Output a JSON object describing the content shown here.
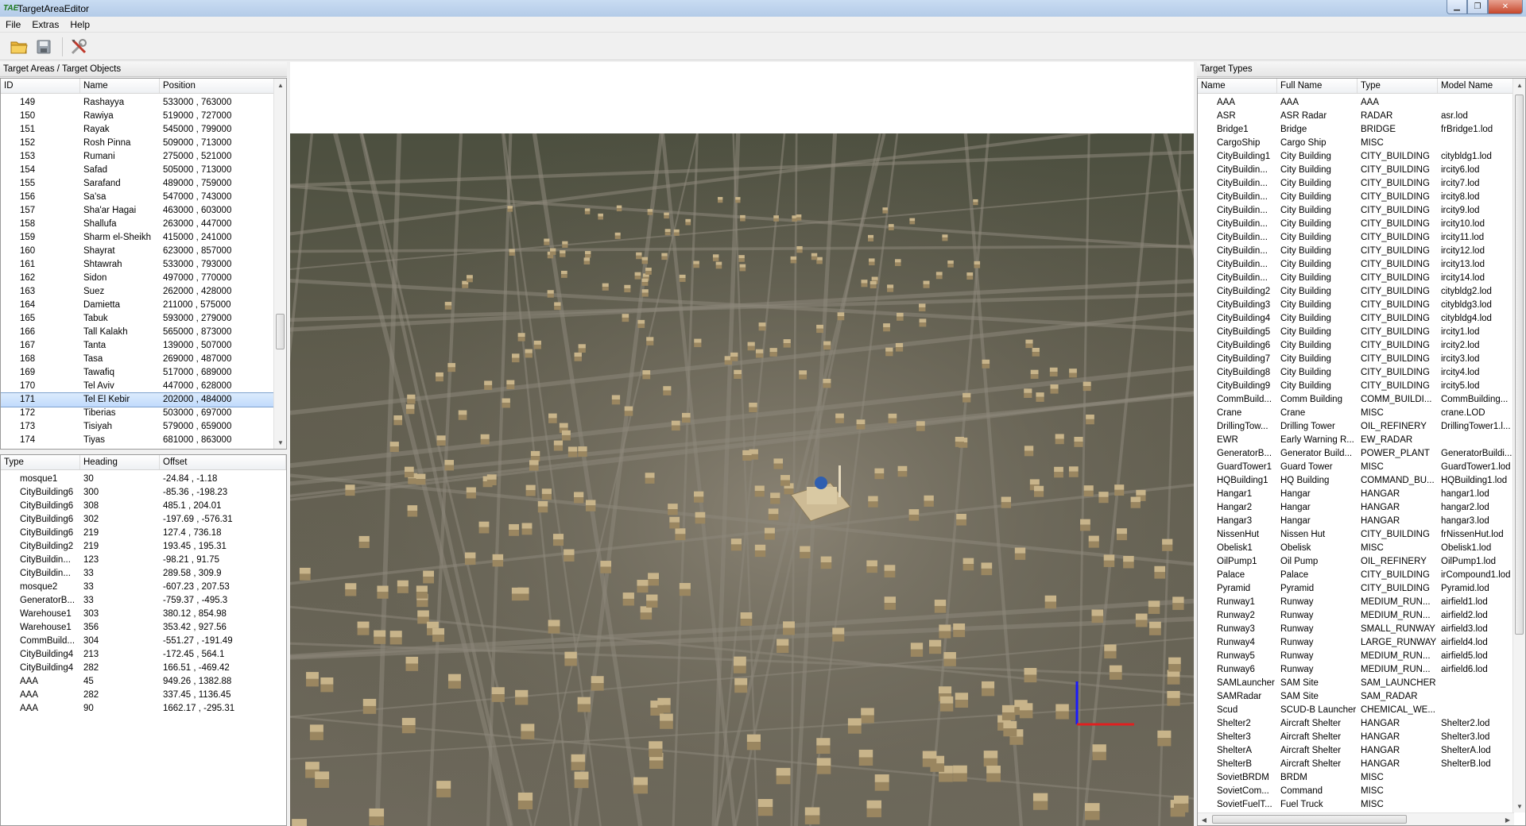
{
  "window": {
    "title": "TargetAreaEditor",
    "app_icon": "TAE"
  },
  "menu": {
    "items": [
      "File",
      "Extras",
      "Help"
    ]
  },
  "toolbar": {
    "icons": [
      "open-folder-icon",
      "save-disk-icon",
      "tools-icon"
    ]
  },
  "areas_panel": {
    "title": "Target Areas / Target Objects",
    "columns": [
      "ID",
      "Name",
      "Position"
    ],
    "rows": [
      [
        "149",
        "Rashayya",
        "533000 , 763000"
      ],
      [
        "150",
        "Rawiya",
        "519000 , 727000"
      ],
      [
        "151",
        "Rayak",
        "545000 , 799000"
      ],
      [
        "152",
        "Rosh Pinna",
        "509000 , 713000"
      ],
      [
        "153",
        "Rumani",
        "275000 , 521000"
      ],
      [
        "154",
        "Safad",
        "505000 , 713000"
      ],
      [
        "155",
        "Sarafand",
        "489000 , 759000"
      ],
      [
        "156",
        "Sa'sa",
        "547000 , 743000"
      ],
      [
        "157",
        "Sha'ar Hagai",
        "463000 , 603000"
      ],
      [
        "158",
        "Shallufa",
        "263000 , 447000"
      ],
      [
        "159",
        "Sharm el-Sheikh",
        "415000 , 241000"
      ],
      [
        "160",
        "Shayrat",
        "623000 , 857000"
      ],
      [
        "161",
        "Shtawrah",
        "533000 , 793000"
      ],
      [
        "162",
        "Sidon",
        "497000 , 770000"
      ],
      [
        "163",
        "Suez",
        "262000 , 428000"
      ],
      [
        "164",
        "Damietta",
        "211000 , 575000"
      ],
      [
        "165",
        "Tabuk",
        "593000 , 279000"
      ],
      [
        "166",
        "Tall Kalakh",
        "565000 , 873000"
      ],
      [
        "167",
        "Tanta",
        "139000 , 507000"
      ],
      [
        "168",
        "Tasa",
        "269000 , 487000"
      ],
      [
        "169",
        "Tawafiq",
        "517000 , 689000"
      ],
      [
        "170",
        "Tel Aviv",
        "447000 , 628000"
      ],
      [
        "171",
        "Tel El Kebir",
        "202000 , 484000"
      ],
      [
        "172",
        "Tiberias",
        "503000 , 697000"
      ],
      [
        "173",
        "Tisiyah",
        "579000 , 659000"
      ],
      [
        "174",
        "Tiyas",
        "681000 , 863000"
      ]
    ],
    "selected_id": "171"
  },
  "objects_panel": {
    "columns": [
      "Type",
      "Heading",
      "Offset"
    ],
    "rows": [
      [
        "mosque1",
        "30",
        "-24.84 , -1.18"
      ],
      [
        "CityBuilding6",
        "300",
        "-85.36 , -198.23"
      ],
      [
        "CityBuilding6",
        "308",
        "485.1 , 204.01"
      ],
      [
        "CityBuilding6",
        "302",
        "-197.69 , -576.31"
      ],
      [
        "CityBuilding6",
        "219",
        "127.4 , 736.18"
      ],
      [
        "CityBuilding2",
        "219",
        "193.45 , 195.31"
      ],
      [
        "CityBuildin...",
        "123",
        "-98.21 , 91.75"
      ],
      [
        "CityBuildin...",
        "33",
        "289.58 , 309.9"
      ],
      [
        "mosque2",
        "33",
        "-607.23 , 207.53"
      ],
      [
        "GeneratorB...",
        "33",
        "-759.37 , -495.3"
      ],
      [
        "Warehouse1",
        "303",
        "380.12 , 854.98"
      ],
      [
        "Warehouse1",
        "356",
        "353.42 , 927.56"
      ],
      [
        "CommBuild...",
        "304",
        "-551.27 , -191.49"
      ],
      [
        "CityBuilding4",
        "213",
        "-172.45 , 564.1"
      ],
      [
        "CityBuilding4",
        "282",
        "166.51 , -469.42"
      ],
      [
        "AAA",
        "45",
        "949.26 , 1382.88"
      ],
      [
        "AAA",
        "282",
        "337.45 , 1136.45"
      ],
      [
        "AAA",
        "90",
        "1662.17 , -295.31"
      ]
    ]
  },
  "types_panel": {
    "title": "Target Types",
    "columns": [
      "Name",
      "Full Name",
      "Type",
      "Model Name"
    ],
    "rows": [
      [
        "AAA",
        "AAA",
        "AAA",
        ""
      ],
      [
        "ASR",
        "ASR Radar",
        "RADAR",
        "asr.lod"
      ],
      [
        "Bridge1",
        "Bridge",
        "BRIDGE",
        "frBridge1.lod"
      ],
      [
        "CargoShip",
        "Cargo Ship",
        "MISC",
        ""
      ],
      [
        "CityBuilding1",
        "City Building",
        "CITY_BUILDING",
        "citybldg1.lod"
      ],
      [
        "CityBuildin...",
        "City Building",
        "CITY_BUILDING",
        "ircity6.lod"
      ],
      [
        "CityBuildin...",
        "City Building",
        "CITY_BUILDING",
        "ircity7.lod"
      ],
      [
        "CityBuildin...",
        "City Building",
        "CITY_BUILDING",
        "ircity8.lod"
      ],
      [
        "CityBuildin...",
        "City Building",
        "CITY_BUILDING",
        "ircity9.lod"
      ],
      [
        "CityBuildin...",
        "City Building",
        "CITY_BUILDING",
        "ircity10.lod"
      ],
      [
        "CityBuildin...",
        "City Building",
        "CITY_BUILDING",
        "ircity11.lod"
      ],
      [
        "CityBuildin...",
        "City Building",
        "CITY_BUILDING",
        "ircity12.lod"
      ],
      [
        "CityBuildin...",
        "City Building",
        "CITY_BUILDING",
        "ircity13.lod"
      ],
      [
        "CityBuildin...",
        "City Building",
        "CITY_BUILDING",
        "ircity14.lod"
      ],
      [
        "CityBuilding2",
        "City Building",
        "CITY_BUILDING",
        "citybldg2.lod"
      ],
      [
        "CityBuilding3",
        "City Building",
        "CITY_BUILDING",
        "citybldg3.lod"
      ],
      [
        "CityBuilding4",
        "City Building",
        "CITY_BUILDING",
        "citybldg4.lod"
      ],
      [
        "CityBuilding5",
        "City Building",
        "CITY_BUILDING",
        "ircity1.lod"
      ],
      [
        "CityBuilding6",
        "City Building",
        "CITY_BUILDING",
        "ircity2.lod"
      ],
      [
        "CityBuilding7",
        "City Building",
        "CITY_BUILDING",
        "ircity3.lod"
      ],
      [
        "CityBuilding8",
        "City Building",
        "CITY_BUILDING",
        "ircity4.lod"
      ],
      [
        "CityBuilding9",
        "City Building",
        "CITY_BUILDING",
        "ircity5.lod"
      ],
      [
        "CommBuild...",
        "Comm Building",
        "COMM_BUILDI...",
        "CommBuilding..."
      ],
      [
        "Crane",
        "Crane",
        "MISC",
        "crane.LOD"
      ],
      [
        "DrillingTow...",
        "Drilling Tower",
        "OIL_REFINERY",
        "DrillingTower1.l..."
      ],
      [
        "EWR",
        "Early Warning R...",
        "EW_RADAR",
        ""
      ],
      [
        "GeneratorB...",
        "Generator Build...",
        "POWER_PLANT",
        "GeneratorBuildi..."
      ],
      [
        "GuardTower1",
        "Guard Tower",
        "MISC",
        "GuardTower1.lod"
      ],
      [
        "HQBuilding1",
        "HQ Building",
        "COMMAND_BU...",
        "HQBuilding1.lod"
      ],
      [
        "Hangar1",
        "Hangar",
        "HANGAR",
        "hangar1.lod"
      ],
      [
        "Hangar2",
        "Hangar",
        "HANGAR",
        "hangar2.lod"
      ],
      [
        "Hangar3",
        "Hangar",
        "HANGAR",
        "hangar3.lod"
      ],
      [
        "NissenHut",
        "Nissen Hut",
        "CITY_BUILDING",
        "frNissenHut.lod"
      ],
      [
        "Obelisk1",
        "Obelisk",
        "MISC",
        "Obelisk1.lod"
      ],
      [
        "OilPump1",
        "Oil Pump",
        "OIL_REFINERY",
        "OilPump1.lod"
      ],
      [
        "Palace",
        "Palace",
        "CITY_BUILDING",
        "irCompound1.lod"
      ],
      [
        "Pyramid",
        "Pyramid",
        "CITY_BUILDING",
        "Pyramid.lod"
      ],
      [
        "Runway1",
        "Runway",
        "MEDIUM_RUN...",
        "airfield1.lod"
      ],
      [
        "Runway2",
        "Runway",
        "MEDIUM_RUN...",
        "airfield2.lod"
      ],
      [
        "Runway3",
        "Runway",
        "SMALL_RUNWAY",
        "airfield3.lod"
      ],
      [
        "Runway4",
        "Runway",
        "LARGE_RUNWAY",
        "airfield4.lod"
      ],
      [
        "Runway5",
        "Runway",
        "MEDIUM_RUN...",
        "airfield5.lod"
      ],
      [
        "Runway6",
        "Runway",
        "MEDIUM_RUN...",
        "airfield6.lod"
      ],
      [
        "SAMLauncher",
        "SAM Site",
        "SAM_LAUNCHER",
        ""
      ],
      [
        "SAMRadar",
        "SAM Site",
        "SAM_RADAR",
        ""
      ],
      [
        "Scud",
        "SCUD-B Launcher",
        "CHEMICAL_WE...",
        ""
      ],
      [
        "Shelter2",
        "Aircraft Shelter",
        "HANGAR",
        "Shelter2.lod"
      ],
      [
        "Shelter3",
        "Aircraft Shelter",
        "HANGAR",
        "Shelter3.lod"
      ],
      [
        "ShelterA",
        "Aircraft Shelter",
        "HANGAR",
        "ShelterA.lod"
      ],
      [
        "ShelterB",
        "Aircraft Shelter",
        "HANGAR",
        "ShelterB.lod"
      ],
      [
        "SovietBRDM",
        "BRDM",
        "MISC",
        ""
      ],
      [
        "SovietCom...",
        "Command",
        "MISC",
        ""
      ],
      [
        "SovietFuelT...",
        "Fuel Truck",
        "MISC",
        ""
      ]
    ]
  },
  "colors": {
    "selection": "#c1dbfc",
    "axis_x": "#e02020",
    "axis_y": "#1a1aff",
    "terrain": "#6f6a5c"
  }
}
